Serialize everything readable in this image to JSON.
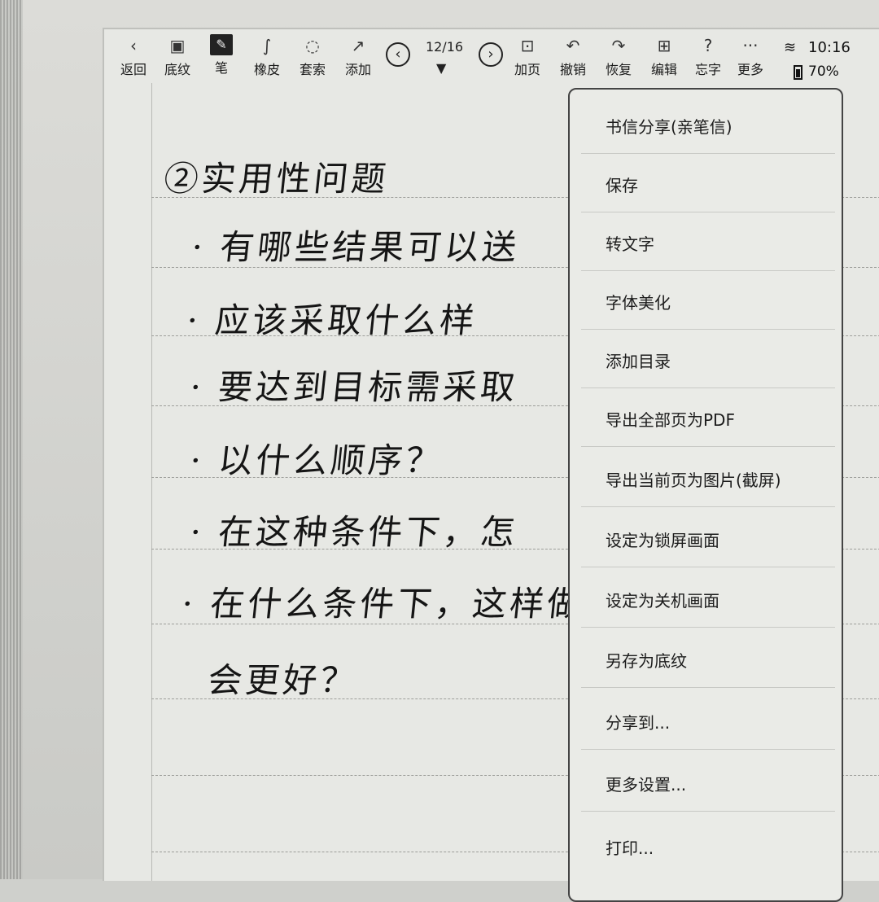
{
  "toolbar": {
    "left_buttons": [
      {
        "icon": "chevron-left-icon",
        "glyph": "‹",
        "label": "返回"
      },
      {
        "icon": "template-icon",
        "glyph": "▣",
        "label": "底纹"
      },
      {
        "icon": "pen-icon",
        "glyph": "✎",
        "label": "笔"
      },
      {
        "icon": "eraser-icon",
        "glyph": "∫",
        "label": "橡皮"
      },
      {
        "icon": "lasso-icon",
        "glyph": "◌",
        "label": "套索"
      },
      {
        "icon": "add-arrow-icon",
        "glyph": "↗",
        "label": "添加"
      }
    ],
    "page_counter": "12/16",
    "right_buttons": [
      {
        "icon": "add-page-icon",
        "glyph": "⊡",
        "label": "加页"
      },
      {
        "icon": "undo-icon",
        "glyph": "↶",
        "label": "撤销"
      },
      {
        "icon": "redo-icon",
        "glyph": "↷",
        "label": "恢复"
      },
      {
        "icon": "grid-icon",
        "glyph": "⊞",
        "label": "编辑"
      },
      {
        "icon": "question-icon",
        "glyph": "?",
        "label": "忘字"
      },
      {
        "icon": "more-dots-icon",
        "glyph": "···",
        "label": "更多"
      }
    ]
  },
  "status": {
    "time": "10:16",
    "battery": "70%"
  },
  "notebook": {
    "lines": [
      "②实用性问题",
      "· 有哪些结果可以送",
      "· 应该采取什么样",
      "· 要达到目标需采取",
      "· 以什么顺序？",
      "· 在这种条件下，怎",
      "· 在什么条件下，这样做",
      "会更好？"
    ]
  },
  "menu": {
    "items": [
      "书信分享(亲笔信)",
      "保存",
      "转文字",
      "字体美化",
      "添加目录",
      "导出全部页为PDF",
      "导出当前页为图片(截屏)",
      "设定为锁屏画面",
      "设定为关机画面",
      "另存为底纹",
      "分享到...",
      "更多设置...",
      "打印..."
    ]
  }
}
